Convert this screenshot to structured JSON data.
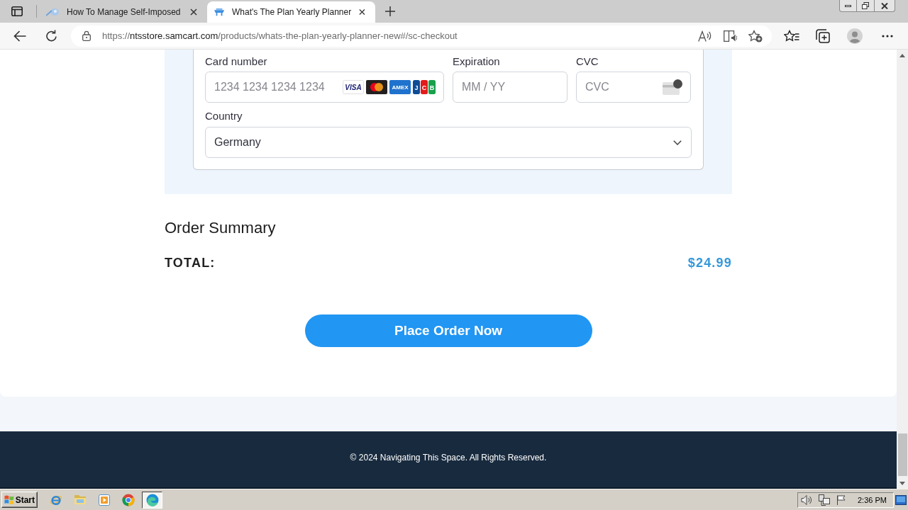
{
  "browser": {
    "tabs": [
      {
        "title": "How To Manage Self-Imposed",
        "selected": false
      },
      {
        "title": "What's The Plan Yearly Planner",
        "selected": true
      }
    ],
    "address": "https://ntsstore.samcart.com/products/whats-the-plan-yearly-planner-new#/sc-checkout"
  },
  "payment": {
    "fields": [
      {
        "kind": "card_number",
        "label": "Card number",
        "placeholder": "1234 1234 1234 1234",
        "brands": [
          {
            "kind": "visa",
            "text": "VISA"
          },
          {
            "kind": "mastercard"
          },
          {
            "kind": "amex",
            "text": "AMEX"
          },
          {
            "kind": "jcb",
            "text": "JCB"
          }
        ]
      },
      {
        "kind": "expiry",
        "label": "Expiration",
        "placeholder": "MM / YY"
      },
      {
        "kind": "cvc",
        "label": "CVC",
        "placeholder": "CVC"
      }
    ],
    "country": {
      "label": "Country",
      "value": "Germany"
    }
  },
  "order_summary": {
    "title": "Order Summary",
    "total_label": "TOTAL:",
    "total_value": "$24.99"
  },
  "place_order_button": {
    "label": "Place Order Now"
  },
  "footer": {
    "copyright": "© 2024 Navigating This Space. All Rights Reserved."
  },
  "taskbar": {
    "start_label": "Start",
    "clock": "2:36 PM"
  }
}
